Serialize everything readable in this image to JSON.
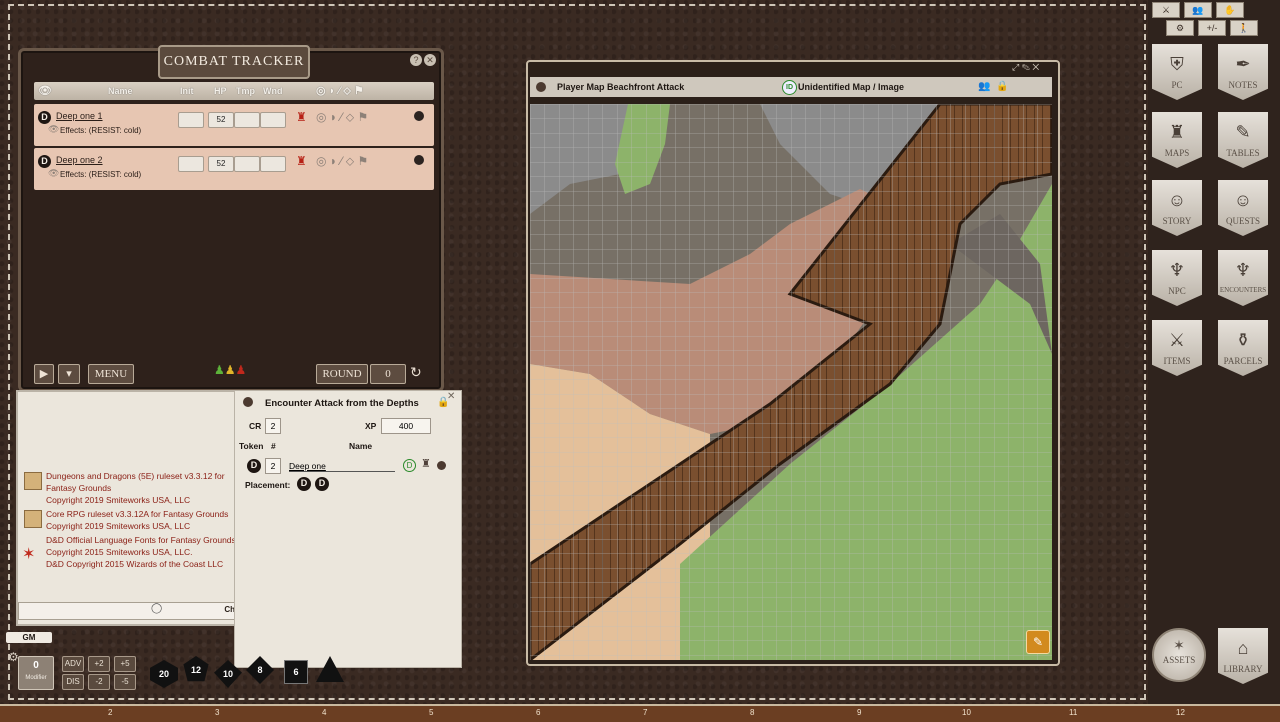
{
  "combat_tracker": {
    "title": "COMBAT TRACKER",
    "columns": {
      "name": "Name",
      "init": "Init",
      "hp": "HP",
      "tmp": "Tmp",
      "wnd": "Wnd"
    },
    "rows": [
      {
        "badge": "D",
        "name": "Deep one 1",
        "effects": "Effects: (RESIST: cold)",
        "hp": "52"
      },
      {
        "badge": "D",
        "name": "Deep one 2",
        "effects": "Effects: (RESIST: cold)",
        "hp": "52"
      }
    ],
    "menu_label": "MENU",
    "round_label": "ROUND",
    "round_value": "0"
  },
  "chat": {
    "entries": [
      {
        "text": "Dungeons and Dragons (5E) ruleset v3.3.12 for Fantasy Grounds",
        "copyright": "Copyright 2019 Smiteworks USA, LLC"
      },
      {
        "text": "Core RPG ruleset v3.3.12A for Fantasy Grounds",
        "copyright": "Copyright 2019 Smiteworks USA, LLC"
      },
      {
        "text": "D&D Official Language Fonts for Fantasy Grounds",
        "copyright": "Copyright 2015 Smiteworks USA, LLC.",
        "copyright2": "D&D Copyright 2015 Wizards of the Coast LLC"
      }
    ],
    "chat_tab": "Ch"
  },
  "encounter": {
    "title": "Encounter Attack from the Depths",
    "cr_label": "CR",
    "cr_value": "2",
    "xp_label": "XP",
    "xp_value": "400",
    "token_label": "Token",
    "count_label": "#",
    "name_label": "Name",
    "npc_badge": "D",
    "npc_count": "2",
    "npc_name": "Deep one",
    "placement_label": "Placement:",
    "placement_tokens": [
      "D",
      "D"
    ]
  },
  "bottom": {
    "gm_label": "GM",
    "modifier_value": "0",
    "modifier_label": "Modifier",
    "adv": "ADV",
    "dis": "DIS",
    "plus2": "+2",
    "plus5": "+5",
    "minus2": "-2",
    "minus5": "-5",
    "dice": [
      "20",
      "12",
      "10",
      "8",
      "6"
    ],
    "ruler_ticks": [
      "2",
      "3",
      "4",
      "5",
      "6",
      "7",
      "8",
      "9",
      "10",
      "11",
      "12"
    ]
  },
  "map_window": {
    "title": "Player Map Beachfront Attack",
    "badge": "ID",
    "status": "Unidentified Map / Image",
    "grid_color": "#b8b8b8",
    "terrain_colors": {
      "rock": "#8b8b8b",
      "sand": "#b98c78",
      "beach": "#e4c09a",
      "wood": "#7a4f2f",
      "grass": "#8db36a",
      "lake": "#777066"
    }
  },
  "sidebar": {
    "top_icons": [
      "⚔",
      "👥",
      "✋",
      "⚙",
      "+/-",
      "🚶"
    ],
    "buttons": [
      {
        "label": "PC",
        "icon": "shield-helmet-icon"
      },
      {
        "label": "NOTES",
        "icon": "quill-icon"
      },
      {
        "label": "MAPS",
        "icon": "castle-icon"
      },
      {
        "label": "TABLES",
        "icon": "scroll-icon"
      },
      {
        "label": "STORY",
        "icon": "masks-icon"
      },
      {
        "label": "QUESTS",
        "icon": "masks-icon"
      },
      {
        "label": "NPC",
        "icon": "demon-icon"
      },
      {
        "label": "ENCOUNTERS",
        "icon": "demon-icon"
      },
      {
        "label": "ITEMS",
        "icon": "sword-icon"
      },
      {
        "label": "PARCELS",
        "icon": "pouch-icon"
      }
    ],
    "assets_label": "ASSETS",
    "library_label": "LIBRARY"
  }
}
